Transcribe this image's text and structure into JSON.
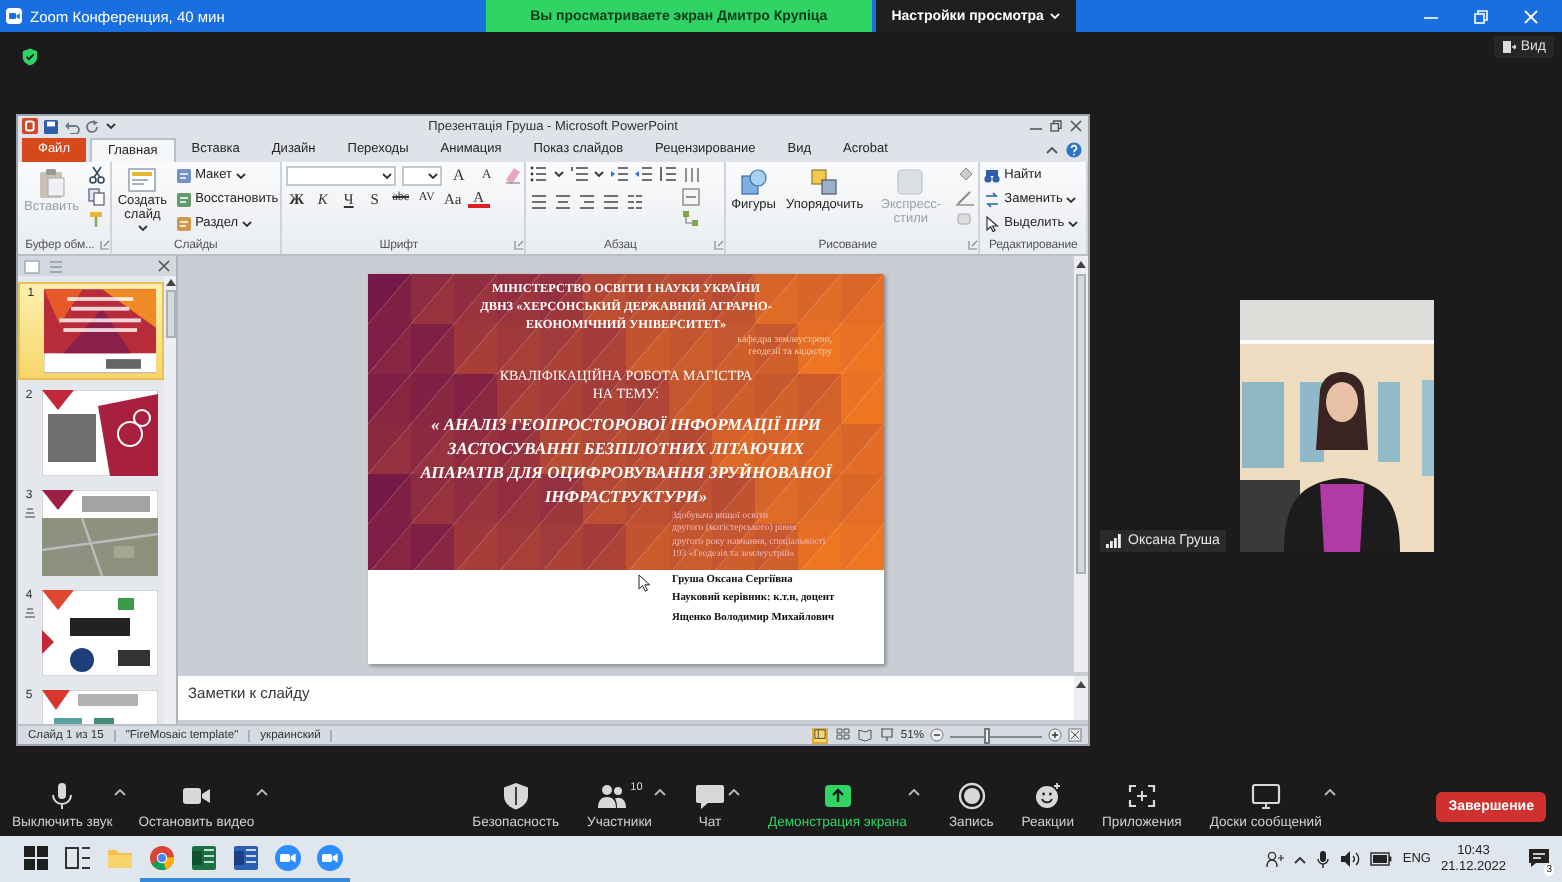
{
  "window": {
    "title": "Zoom Конференция, 40 мин"
  },
  "share_banner": {
    "text": "Вы просматриваете экран Дмитро Крупіца",
    "view_options": "Настройки просмотра"
  },
  "view_button": "Вид",
  "shared_screen": {
    "title": "Презентація Груша - Microsoft PowerPoint",
    "tabs": [
      {
        "label": "Файл",
        "kind": "file",
        "selected": false
      },
      {
        "label": "Главная",
        "kind": "tab",
        "selected": true
      },
      {
        "label": "Вставка",
        "kind": "tab",
        "selected": false
      },
      {
        "label": "Дизайн",
        "kind": "tab",
        "selected": false
      },
      {
        "label": "Переходы",
        "kind": "tab",
        "selected": false
      },
      {
        "label": "Анимация",
        "kind": "tab",
        "selected": false
      },
      {
        "label": "Показ слайдов",
        "kind": "tab",
        "selected": false
      },
      {
        "label": "Рецензирование",
        "kind": "tab",
        "selected": false
      },
      {
        "label": "Вид",
        "kind": "tab",
        "selected": false
      },
      {
        "label": "Acrobat",
        "kind": "tab",
        "selected": false
      }
    ],
    "ribbon_groups": [
      {
        "kind": "clipboard",
        "label": "Буфер обм...",
        "paste": {
          "label": "Вставить",
          "disabled": true
        }
      },
      {
        "kind": "slides",
        "label": "Слайды",
        "new_slide": "Создать слайд",
        "commands": [
          {
            "label": "Макет",
            "dropdown": true
          },
          {
            "label": "Восстановить",
            "dropdown": false
          },
          {
            "label": "Раздел",
            "dropdown": true
          }
        ]
      },
      {
        "kind": "font",
        "label": "Шрифт",
        "size_buttons": [
          "A",
          "A"
        ],
        "format_buttons": [
          "Ж",
          "К",
          "Ч",
          "S",
          "abc",
          "AV",
          "Aa",
          "A"
        ]
      },
      {
        "kind": "paragraph",
        "label": "Абзац"
      },
      {
        "kind": "drawing",
        "label": "Рисование",
        "commands": [
          {
            "label": "Фигуры",
            "disabled": false
          },
          {
            "label": "Упорядочить",
            "disabled": false
          },
          {
            "label": "Экспресс-стили",
            "disabled": true
          }
        ]
      },
      {
        "kind": "editing",
        "label": "Редактирование",
        "commands": [
          {
            "label": "Найти",
            "dropdown": false
          },
          {
            "label": "Заменить",
            "dropdown": true
          },
          {
            "label": "Выделить",
            "dropdown": true
          }
        ]
      }
    ],
    "slides": [
      {
        "number": "1",
        "selected": true,
        "animated": false
      },
      {
        "number": "2",
        "selected": false,
        "animated": false
      },
      {
        "number": "3",
        "selected": false,
        "animated": true
      },
      {
        "number": "4",
        "selected": false,
        "animated": true
      },
      {
        "number": "5",
        "selected": false,
        "animated": false
      }
    ],
    "slide": {
      "header": "МІНІСТЕРСТВО  ОСВІТИ І НАУКИ УКРАЇНИ\nДВНЗ «ХЕРСОНСЬКИЙ ДЕРЖАВНИЙ АГРАРНО-\nЕКОНОМІЧНИЙ УНІВЕРСИТЕТ»",
      "department": "кафедра землеустрою,\nгеодезії та кадастру",
      "work_type": "КВАЛІФІКАЦІЙНА РОБОТА МАГІСТРА\nНА ТЕМУ:",
      "topic": "« АНАЛІЗ ГЕОПРОСТОРОВОЇ ІНФОРМАЦІЇ ПРИ\nЗАСТОСУВАННІ БЕЗПІЛОТНИХ ЛІТАЮЧИХ\nАПАРАТІВ ДЛЯ ОЦИФРОВУВАННЯ ЗРУЙНОВАНОЇ\nІНФРАСТРУКТУРИ»",
      "student_info": "Здобувача вищої освіти\nдругого (магістерського) рівня\nдругого року навчання, спеціальності\n193 «Геодезія та землеустрій»",
      "authors": "Груша Оксана Сергіївна\nНауковий керівник: к.т.н, доцент\nЯщенко Володимир Михайлович"
    },
    "notes_placeholder": "Заметки к слайду",
    "status_bar": {
      "slide_info": "Слайд 1 из 15",
      "theme": "\"FireMosaic template\"",
      "language": "украинский",
      "views": [
        {
          "kind": "normal",
          "selected": true
        },
        {
          "kind": "sorter",
          "selected": false
        },
        {
          "kind": "reading",
          "selected": false
        },
        {
          "kind": "slideshow",
          "selected": false
        }
      ],
      "zoom": "51%",
      "zoom_slider": {
        "level": 0.4
      }
    }
  },
  "video": {
    "name": "Оксана Груша"
  },
  "toolbar": {
    "items": [
      {
        "kind": "mic",
        "label": "Выключить звук",
        "caret": true
      },
      {
        "kind": "video",
        "label": "Остановить видео",
        "caret": true
      },
      {
        "kind": "security",
        "label": "Безопасность",
        "caret": false
      },
      {
        "kind": "participants",
        "label": "Участники",
        "count": "10",
        "caret": true
      },
      {
        "kind": "chat",
        "label": "Чат",
        "caret": true
      },
      {
        "kind": "share",
        "label": "Демонстрация экрана",
        "caret": true
      },
      {
        "kind": "record",
        "label": "Запись",
        "caret": false
      },
      {
        "kind": "reactions",
        "label": "Реакции",
        "caret": false
      },
      {
        "kind": "apps",
        "label": "Приложения",
        "caret": false
      },
      {
        "kind": "boards",
        "label": "Доски сообщений",
        "caret": true
      }
    ],
    "end_button": "Завершение"
  },
  "taskbar": {
    "apps": [
      {
        "kind": "start",
        "running": false
      },
      {
        "kind": "taskview",
        "running": false
      },
      {
        "kind": "folder",
        "running": false
      },
      {
        "kind": "browser",
        "running": true
      },
      {
        "kind": "spreadsheet",
        "running": true
      },
      {
        "kind": "document",
        "running": true
      },
      {
        "kind": "meeting",
        "running": true
      },
      {
        "kind": "meeting",
        "running": true
      }
    ],
    "language": "ENG",
    "time": "10:43",
    "date": "21.12.2022",
    "notifications": "3"
  }
}
